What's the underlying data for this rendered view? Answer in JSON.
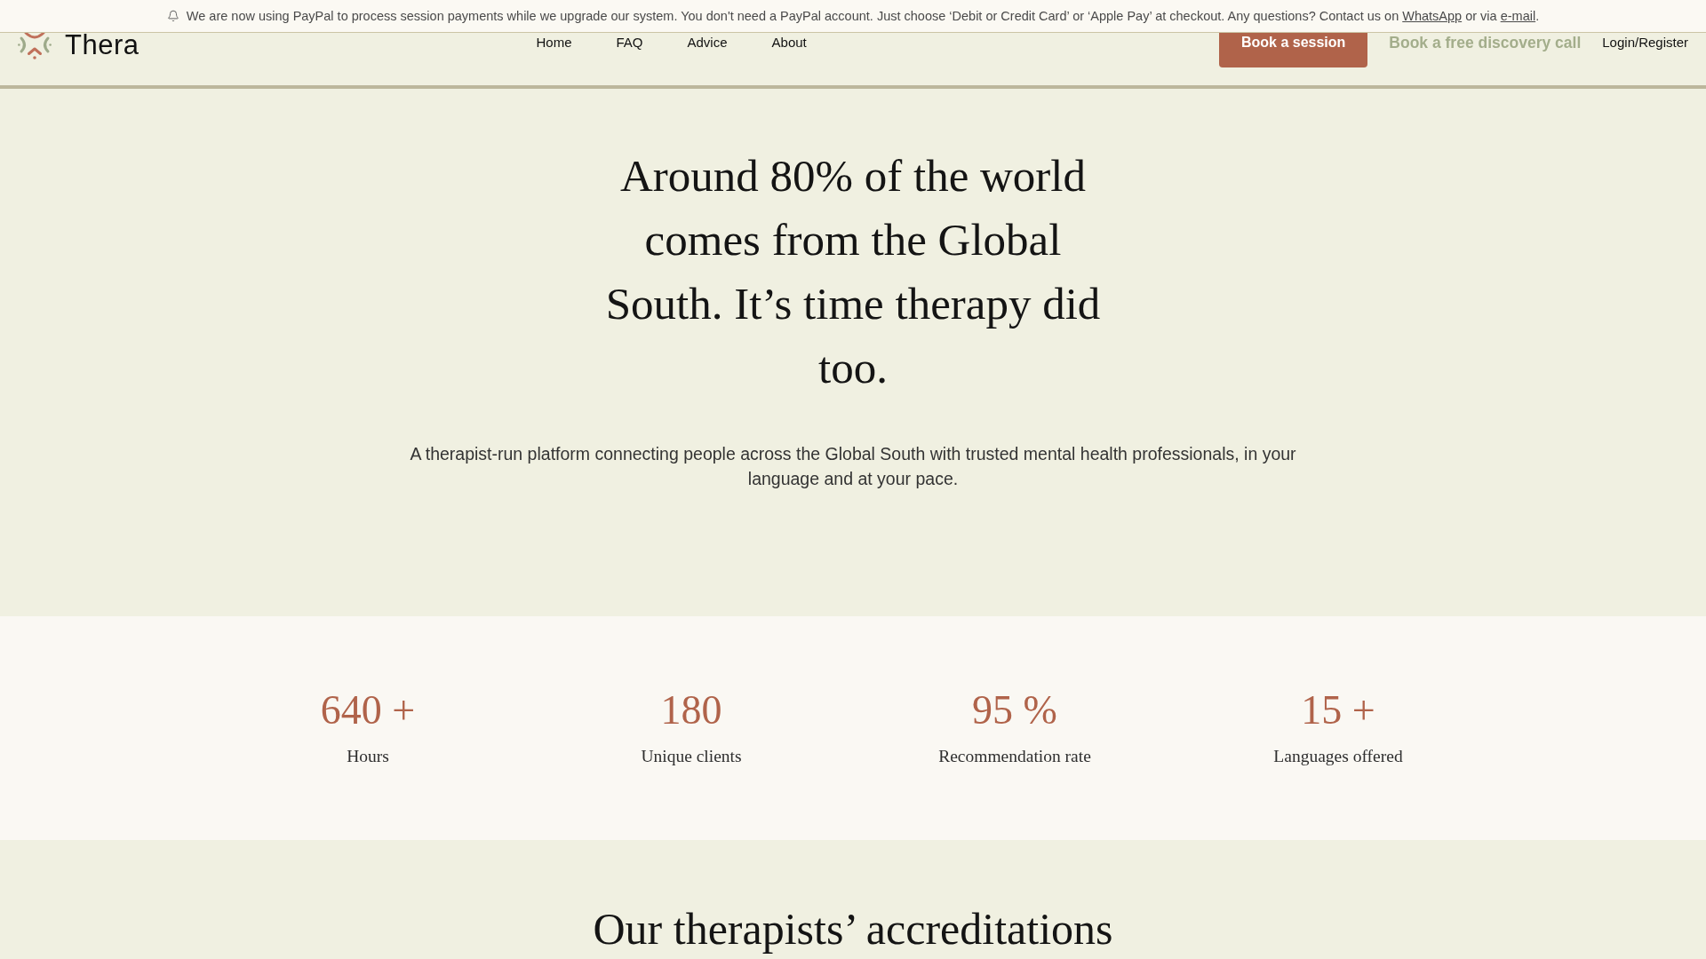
{
  "announcement": {
    "parts": [
      {
        "kind": "text",
        "text": "We are now using PayPal to process session payments while we upgrade our system. You don't need a PayPal account. Just choose ‘Debit or Credit Card’ or ‘Apple Pay’ at checkout. Any questions? Contact us on "
      },
      {
        "kind": "link",
        "text": "WhatsApp"
      },
      {
        "kind": "text",
        "text": " or via "
      },
      {
        "kind": "link",
        "text": "e-mail"
      },
      {
        "kind": "text",
        "text": "."
      }
    ]
  },
  "header": {
    "logo": "Thera",
    "nav_links": [
      "Home",
      "FAQ",
      "Advice",
      "About"
    ],
    "actions": [
      {
        "kind": "primary",
        "label": "Book a session"
      },
      {
        "kind": "accent",
        "label": "Book a free discovery call"
      },
      {
        "kind": "plain",
        "label": "Login/Register"
      }
    ]
  },
  "hero": {
    "title": "Around 80% of the world comes from the Global South. It’s time therapy did too.",
    "subtitle": "A therapist-run platform connecting people across the Global South with trusted mental health professionals, in your language and at your pace."
  },
  "stats": [
    {
      "value": "640 +",
      "label": "Hours"
    },
    {
      "value": "180",
      "label": "Unique clients"
    },
    {
      "value": "95 %",
      "label": "Recommendation rate"
    },
    {
      "value": "15 +",
      "label": "Languages offered"
    }
  ],
  "accreditations": {
    "title": "Our therapists’ accreditations"
  }
}
